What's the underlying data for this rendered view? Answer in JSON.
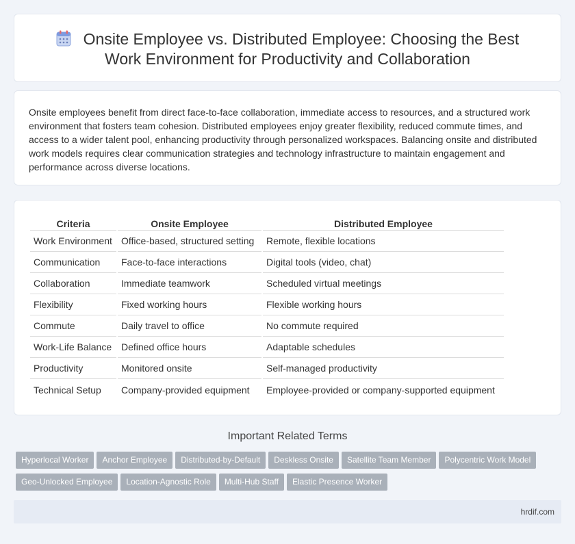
{
  "header": {
    "title_line1": "Onsite Employee vs. Distributed Employee: Choosing the Best",
    "title_line2": "Work Environment for Productivity and Collaboration",
    "icon": "calendar-icon"
  },
  "intro": {
    "text": "Onsite employees benefit from direct face-to-face collaboration, immediate access to resources, and a structured work environment that fosters team cohesion. Distributed employees enjoy greater flexibility, reduced commute times, and access to a wider talent pool, enhancing productivity through personalized workspaces. Balancing onsite and distributed work models requires clear communication strategies and technology infrastructure to maintain engagement and performance across diverse locations."
  },
  "table": {
    "headers": [
      "Criteria",
      "Onsite Employee",
      "Distributed Employee"
    ],
    "rows": [
      [
        "Work Environment",
        "Office-based, structured setting",
        "Remote, flexible locations"
      ],
      [
        "Communication",
        "Face-to-face interactions",
        "Digital tools (video, chat)"
      ],
      [
        "Collaboration",
        "Immediate teamwork",
        "Scheduled virtual meetings"
      ],
      [
        "Flexibility",
        "Fixed working hours",
        "Flexible working hours"
      ],
      [
        "Commute",
        "Daily travel to office",
        "No commute required"
      ],
      [
        "Work-Life Balance",
        "Defined office hours",
        "Adaptable schedules"
      ],
      [
        "Productivity",
        "Monitored onsite",
        "Self-managed productivity"
      ],
      [
        "Technical Setup",
        "Company-provided equipment",
        "Employee-provided or company-supported equipment"
      ]
    ]
  },
  "related": {
    "title": "Important Related Terms",
    "tags": [
      "Hyperlocal Worker",
      "Anchor Employee",
      "Distributed-by-Default",
      "Deskless Onsite",
      "Satellite Team Member",
      "Polycentric Work Model",
      "Geo-Unlocked Employee",
      "Location-Agnostic Role",
      "Multi-Hub Staff",
      "Elastic Presence Worker"
    ]
  },
  "footer": {
    "site": "hrdif.com"
  }
}
